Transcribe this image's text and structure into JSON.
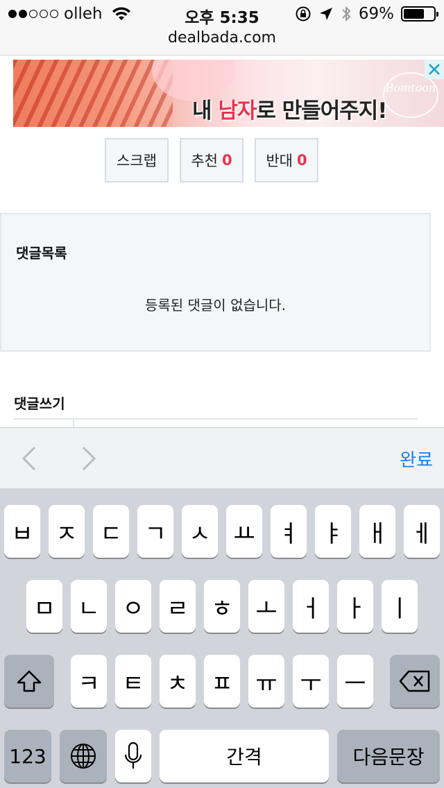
{
  "status_bar": {
    "signal_bars_filled": 2,
    "signal_bars_total": 5,
    "carrier": "olleh",
    "time": "오후 5:35",
    "battery_percent": "69%",
    "battery_level": 0.69
  },
  "browser": {
    "url": "dealbada.com"
  },
  "ad_banner": {
    "text_before": "내 ",
    "text_highlight": "남자",
    "text_after": "로 만들어주지!",
    "logo_text": "Bomtoon"
  },
  "vote_buttons": {
    "scrap_label": "스크랩",
    "recommend_label": "추천",
    "recommend_count": "0",
    "oppose_label": "반대",
    "oppose_count": "0"
  },
  "comments": {
    "title": "댓글목록",
    "empty_message": "등록된 댓글이 없습니다."
  },
  "comment_write": {
    "title": "댓글쓰기"
  },
  "accessory_bar": {
    "done_label": "완료"
  },
  "keyboard": {
    "row1": [
      "ㅂ",
      "ㅈ",
      "ㄷ",
      "ㄱ",
      "ㅅ",
      "ㅛ",
      "ㅕ",
      "ㅑ",
      "ㅐ",
      "ㅔ"
    ],
    "row2": [
      "ㅁ",
      "ㄴ",
      "ㅇ",
      "ㄹ",
      "ㅎ",
      "ㅗ",
      "ㅓ",
      "ㅏ",
      "ㅣ"
    ],
    "row3": [
      "ㅋ",
      "ㅌ",
      "ㅊ",
      "ㅍ",
      "ㅠ",
      "ㅜ",
      "ㅡ"
    ],
    "numbers_label": "123",
    "space_label": "간격",
    "return_label": "다음문장"
  },
  "colors": {
    "accent_blue": "#1a7cf5",
    "count_red": "#e8344f",
    "keyboard_bg": "#d1d5db"
  }
}
